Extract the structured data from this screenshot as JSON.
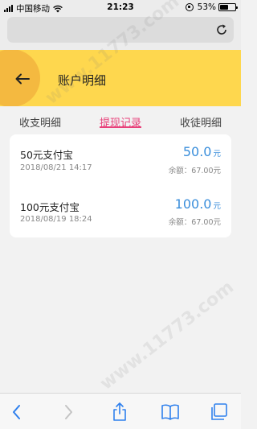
{
  "status_bar": {
    "carrier": "中国移动",
    "time": "21:23",
    "battery_text": "53%",
    "battery_level": 0.53
  },
  "header": {
    "title": "账户明细",
    "back_icon": "arrow-left-icon"
  },
  "tabs": [
    {
      "label": "收支明细"
    },
    {
      "label": "提现记录"
    },
    {
      "label": "收徒明细"
    }
  ],
  "active_tab": 1,
  "records": [
    {
      "title": "50元支付宝",
      "date": "2018/08/21 14:17",
      "amount": "50.0",
      "unit": "元",
      "balance": "余额：67.00元"
    },
    {
      "title": "100元支付宝",
      "date": "2018/08/19 18:24",
      "amount": "100.0",
      "unit": "元",
      "balance": "余额：67.00元"
    }
  ],
  "watermark": "www.11773.com",
  "colors": {
    "header_bg": "#fed74e",
    "accent": "#e8417a",
    "amount": "#3a8edb"
  }
}
